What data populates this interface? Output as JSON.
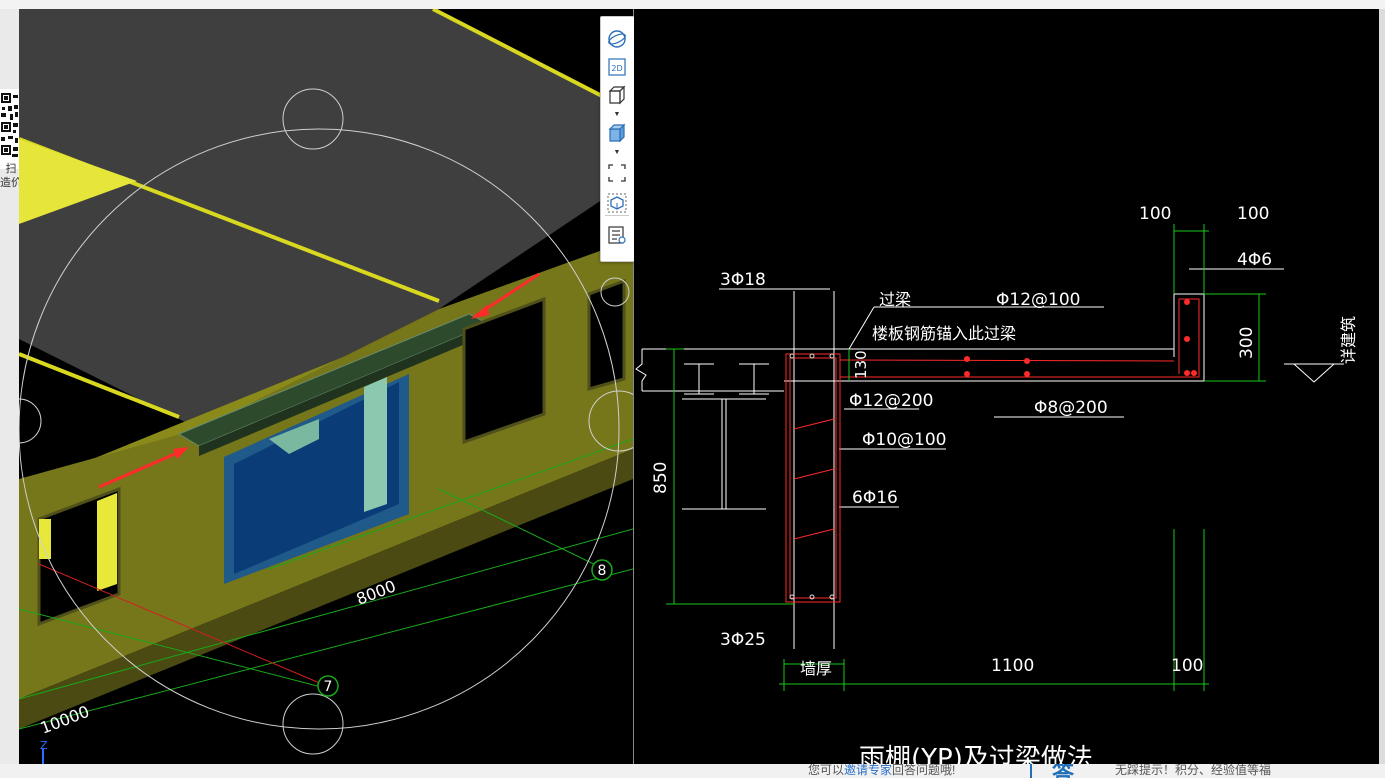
{
  "left_panel": {
    "qr_caption_line1": "扫",
    "qr_caption_line2": "造价"
  },
  "view3d": {
    "axis_labels": [
      "8",
      "7"
    ],
    "dim_8000": "8000",
    "dim_10000": "10000",
    "z_axis_label": "Z"
  },
  "toolbar": {
    "items": [
      {
        "name": "orbit-icon"
      },
      {
        "name": "2d-view-icon",
        "text": "2D"
      },
      {
        "name": "3d-view-icon"
      },
      {
        "name": "solid-view-icon"
      },
      {
        "name": "fullscreen-icon"
      },
      {
        "name": "component-display-icon"
      },
      {
        "name": "properties-list-icon"
      }
    ]
  },
  "cad": {
    "labels": {
      "top_rebar_left": "3Φ18",
      "lintel_beam": "过梁",
      "slab_rebar_note": "楼板钢筋锚入此过梁",
      "slab_top_rebar": "Φ12@100",
      "dim_100_a": "100",
      "dim_100_b": "100",
      "edge_rebar": "4Φ6",
      "dim_300": "300",
      "see_architecture": "详建筑",
      "dim_130": "130",
      "stirrup_200": "Φ12@200",
      "distribution_rebar": "Φ8@200",
      "stirrup_100": "Φ10@100",
      "side_rebar": "6Φ16",
      "dim_850": "850",
      "bottom_rebar": "3Φ25",
      "wall_thickness": "墙厚",
      "dim_1100": "1100",
      "dim_100_c": "100",
      "title": "雨棚(YP)及过梁做法"
    }
  },
  "bottom_bar": {
    "hint_prefix": "您可以",
    "hint_link": "邀请专家",
    "hint_suffix": "回答问题哦!",
    "answer_badge": "答",
    "promo": "无踩提示！积分、经验值等福"
  }
}
